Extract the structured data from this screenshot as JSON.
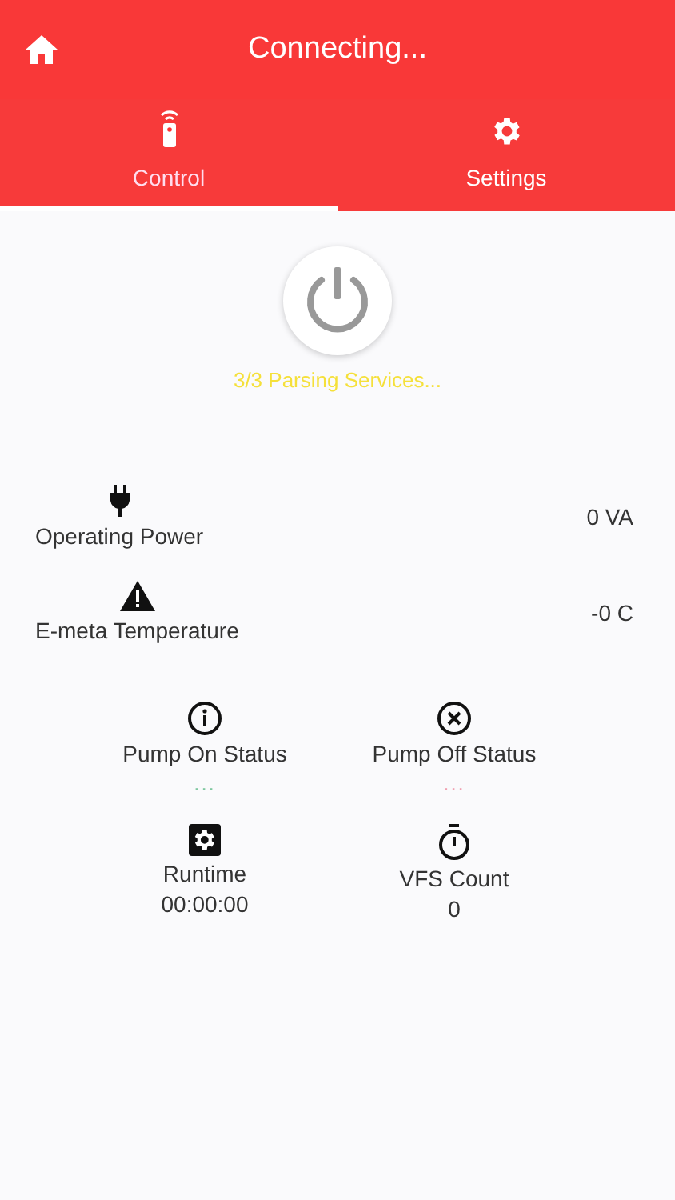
{
  "header": {
    "title": "Connecting..."
  },
  "tabs": [
    {
      "label": "Control",
      "selected": true
    },
    {
      "label": "Settings",
      "selected": false
    }
  ],
  "power": {
    "status": "3/3 Parsing Services..."
  },
  "readings": [
    {
      "label": "Operating Power",
      "value": "0 VA"
    },
    {
      "label": "E-meta Temperature",
      "value": "-0 C"
    }
  ],
  "tiles": [
    {
      "label": "Pump On Status",
      "value": "...",
      "color": "#7fc8a0"
    },
    {
      "label": "Pump Off Status",
      "value": "...",
      "color": "#f0a0b0"
    },
    {
      "label": "Runtime",
      "value": "00:00:00"
    },
    {
      "label": "VFS Count",
      "value": "0"
    }
  ]
}
